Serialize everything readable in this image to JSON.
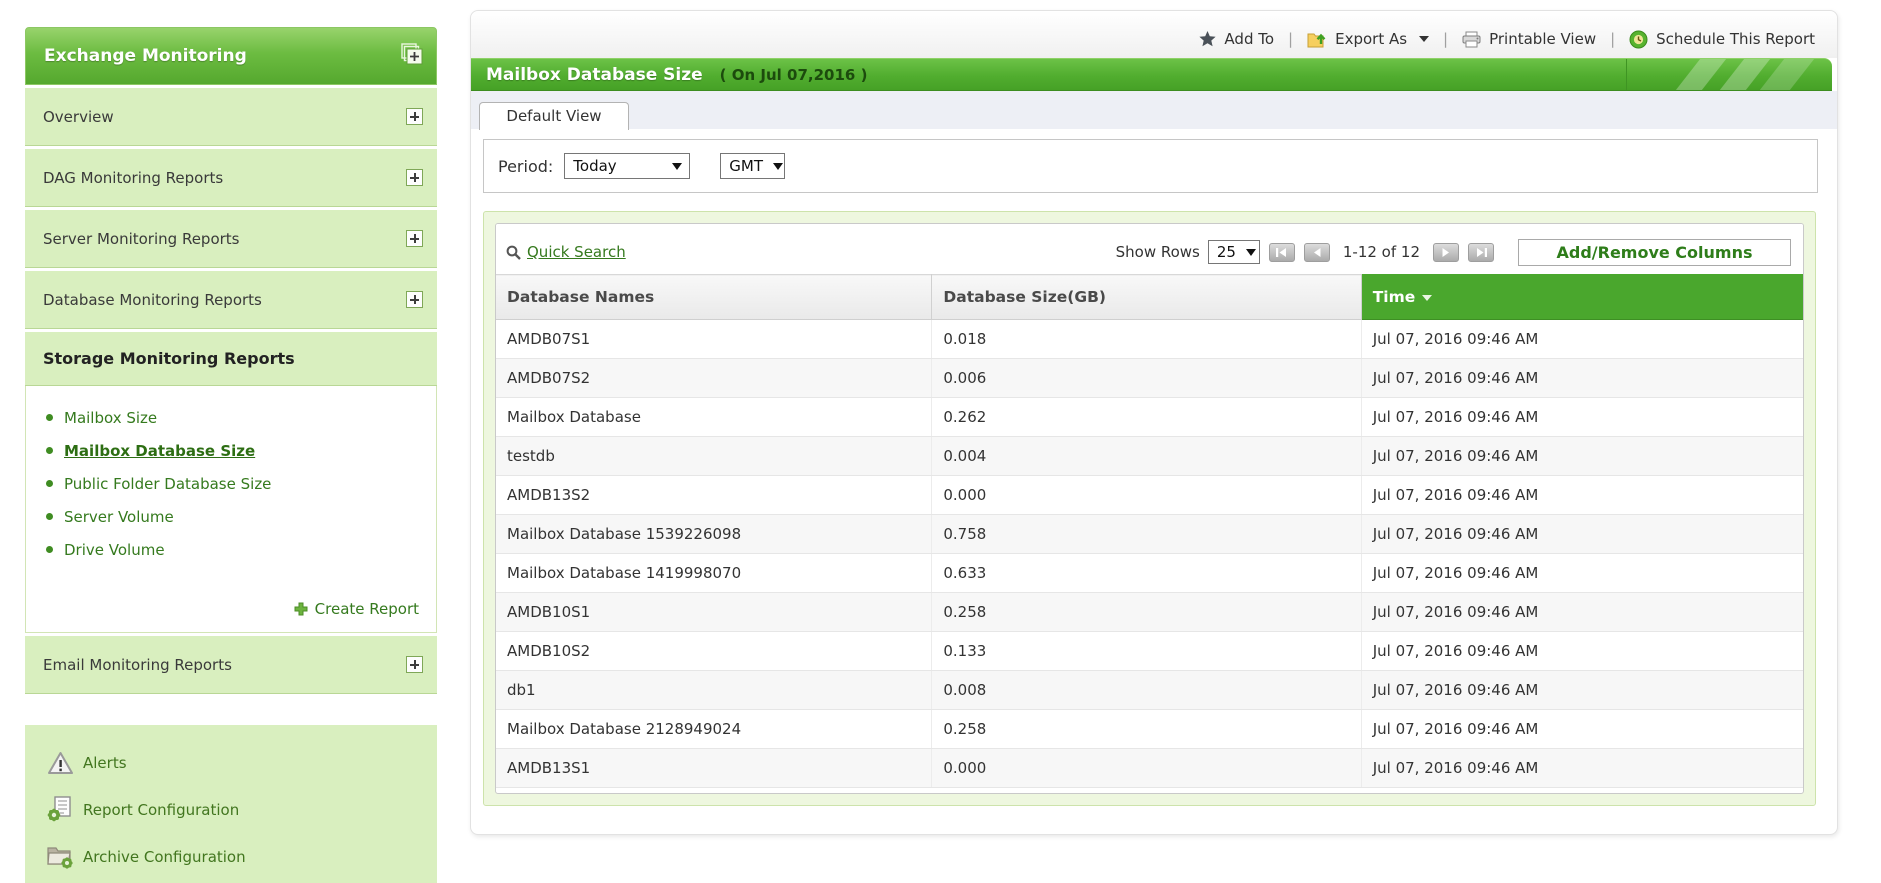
{
  "sidebar": {
    "title": "Exchange Monitoring",
    "sections": [
      {
        "label": "Overview"
      },
      {
        "label": "DAG Monitoring Reports"
      },
      {
        "label": "Server Monitoring Reports"
      },
      {
        "label": "Database Monitoring Reports"
      }
    ],
    "expanded_section": "Storage Monitoring Reports",
    "storage_items": [
      {
        "label": "Mailbox Size",
        "selected": false
      },
      {
        "label": "Mailbox Database Size",
        "selected": true
      },
      {
        "label": "Public Folder Database Size",
        "selected": false
      },
      {
        "label": "Server Volume",
        "selected": false
      },
      {
        "label": "Drive Volume",
        "selected": false
      }
    ],
    "create_report_label": "Create Report",
    "email_section": "Email Monitoring Reports",
    "tools": [
      {
        "icon": "alert-icon",
        "label": "Alerts"
      },
      {
        "icon": "report-config-icon",
        "label": "Report Configuration"
      },
      {
        "icon": "archive-config-icon",
        "label": "Archive Configuration"
      }
    ]
  },
  "toolbar": {
    "add_to": "Add To",
    "export_as": "Export As",
    "printable_view": "Printable View",
    "schedule": "Schedule This Report"
  },
  "report": {
    "title": "Mailbox Database Size",
    "subtitle": "( On Jul 07,2016 )",
    "tab": "Default View"
  },
  "filters": {
    "period_label": "Period:",
    "period_value": "Today",
    "timezone_value": "GMT"
  },
  "table": {
    "quick_search": "Quick Search",
    "show_rows_label": "Show Rows",
    "show_rows_value": "25",
    "page_info": "1-12 of 12",
    "add_remove_label": "Add/Remove Columns",
    "columns": [
      "Database Names",
      "Database Size(GB)",
      "Time"
    ],
    "rows": [
      [
        "AMDB07S1",
        "0.018",
        "Jul 07, 2016 09:46 AM"
      ],
      [
        "AMDB07S2",
        "0.006",
        "Jul 07, 2016 09:46 AM"
      ],
      [
        "Mailbox Database",
        "0.262",
        "Jul 07, 2016 09:46 AM"
      ],
      [
        "testdb",
        "0.004",
        "Jul 07, 2016 09:46 AM"
      ],
      [
        "AMDB13S2",
        "0.000",
        "Jul 07, 2016 09:46 AM"
      ],
      [
        "Mailbox Database 1539226098",
        "0.758",
        "Jul 07, 2016 09:46 AM"
      ],
      [
        "Mailbox Database 1419998070",
        "0.633",
        "Jul 07, 2016 09:46 AM"
      ],
      [
        "AMDB10S1",
        "0.258",
        "Jul 07, 2016 09:46 AM"
      ],
      [
        "AMDB10S2",
        "0.133",
        "Jul 07, 2016 09:46 AM"
      ],
      [
        "db1",
        "0.008",
        "Jul 07, 2016 09:46 AM"
      ],
      [
        "Mailbox Database 2128949024",
        "0.258",
        "Jul 07, 2016 09:46 AM"
      ],
      [
        "AMDB13S1",
        "0.000",
        "Jul 07, 2016 09:46 AM"
      ]
    ]
  },
  "colors": {
    "accent_green": "#4aa72d",
    "sidebar_item_bg": "#d9efbf",
    "link_green": "#35791d"
  }
}
